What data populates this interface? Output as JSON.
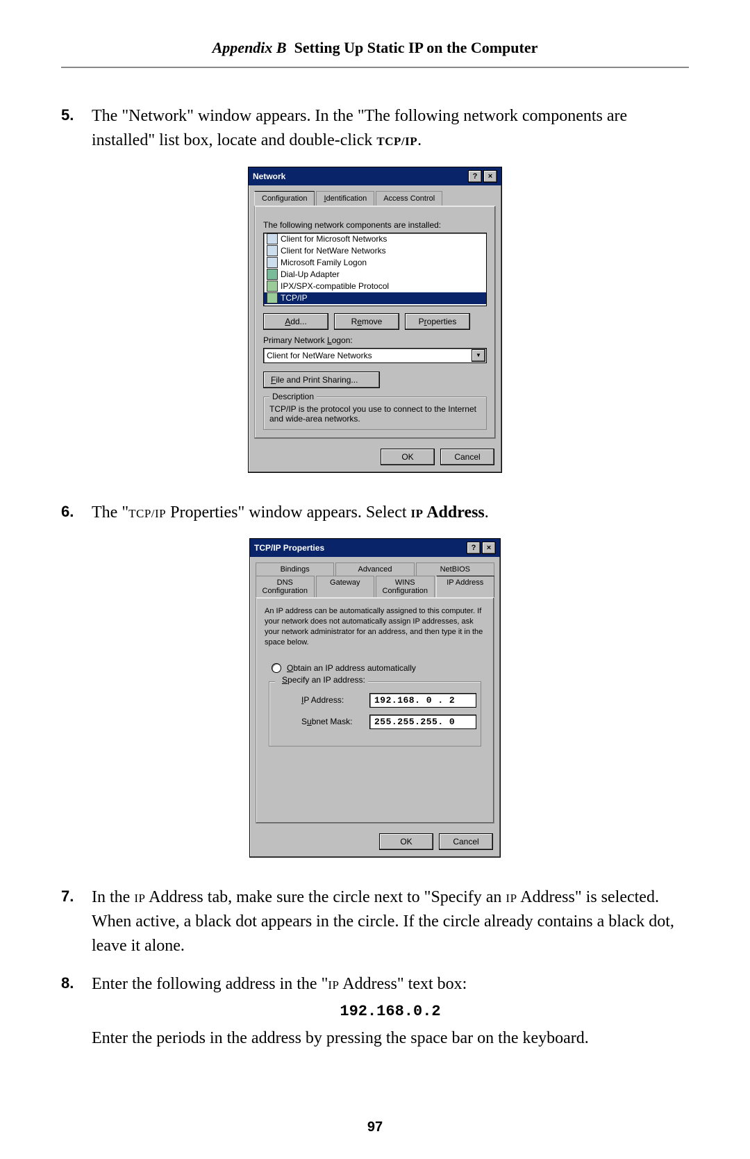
{
  "header": {
    "prefix": "Appendix B",
    "title": "Setting Up Static IP on the Computer"
  },
  "pageNumber": "97",
  "steps": {
    "s5": {
      "num": "5.",
      "text_a": "The \"Network\" window appears. In the \"The following network components are installed\" list box, locate and double-click ",
      "tcpip": "TCP/IP",
      "text_b": "."
    },
    "s6": {
      "num": "6.",
      "text_a": "The \"",
      "sc1": "TCP/IP",
      "text_b": " Properties\" window appears. Select ",
      "sc2": "IP",
      "bold": " Address",
      "text_c": "."
    },
    "s7": {
      "num": "7.",
      "text_a": "In the ",
      "sc1": "IP",
      "text_b": " Address tab, make sure the circle next to \"Specify an ",
      "sc2": "IP",
      "text_c": " Address\" is selected. When active, a black dot appears in the circle. If the circle already contains a black dot, leave it alone."
    },
    "s8": {
      "num": "8.",
      "text_a": "Enter the following address in the \"",
      "sc1": "IP",
      "text_b": " Address\" text box:",
      "code": "192.168.0.2",
      "text_c": "Enter the periods in the address by pressing the space bar on the keyboard."
    }
  },
  "dlg1": {
    "title": "Network",
    "help": "?",
    "close": "×",
    "tabs": {
      "config": "Configuration",
      "ident": "Identification",
      "access": "Access Control"
    },
    "installed_label": "The following network components are installed:",
    "items": [
      "Client for Microsoft Networks",
      "Client for NetWare Networks",
      "Microsoft Family Logon",
      "Dial-Up Adapter",
      "IPX/SPX-compatible Protocol",
      "TCP/IP"
    ],
    "add": "Add...",
    "remove": "Remove",
    "properties": "Properties",
    "primary_label": "Primary Network Logon:",
    "primary_value": "Client for NetWare Networks",
    "fileprint": "File and Print Sharing...",
    "desc_legend": "Description",
    "desc_text": "TCP/IP is the protocol you use to connect to the Internet and wide-area networks.",
    "ok": "OK",
    "cancel": "Cancel"
  },
  "dlg2": {
    "title": "TCP/IP Properties",
    "help": "?",
    "close": "×",
    "tabs_top": {
      "bindings": "Bindings",
      "advanced": "Advanced",
      "netbios": "NetBIOS"
    },
    "tabs_bot": {
      "dns": "DNS Configuration",
      "gateway": "Gateway",
      "wins": "WINS Configuration",
      "ip": "IP Address"
    },
    "intro": "An IP address can be automatically assigned to this computer. If your network does not automatically assign IP addresses, ask your network administrator for an address, and then type it in the space below.",
    "radio_auto": "Obtain an IP address automatically",
    "radio_specify": "Specify an IP address:",
    "ip_label": "IP Address:",
    "ip_value": "192.168. 0 . 2",
    "mask_label": "Subnet Mask:",
    "mask_value": "255.255.255. 0",
    "ok": "OK",
    "cancel": "Cancel"
  }
}
